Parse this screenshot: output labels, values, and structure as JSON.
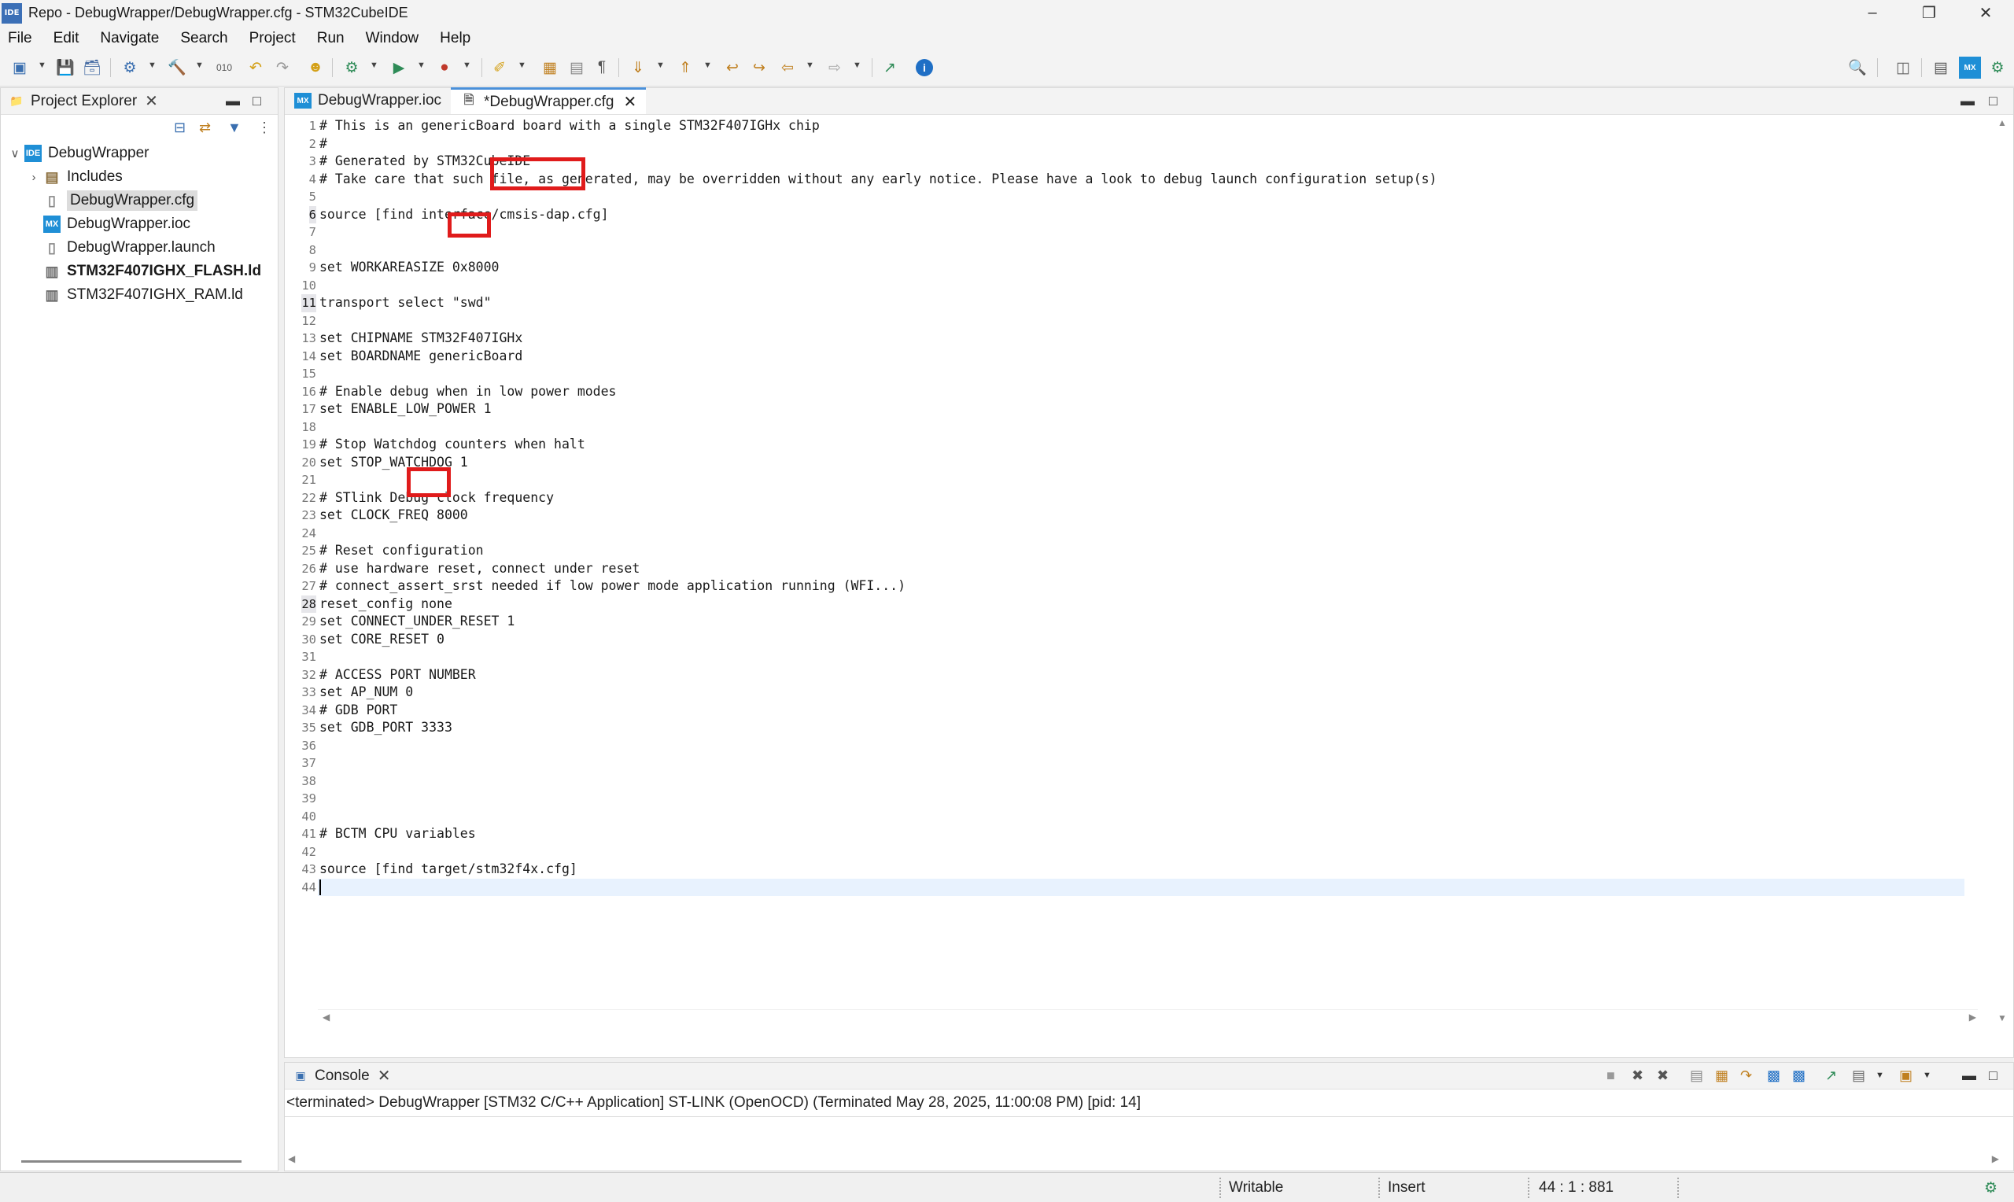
{
  "window": {
    "title": "Repo - DebugWrapper/DebugWrapper.cfg - STM32CubeIDE",
    "icon_text": "IDE"
  },
  "menu": [
    "File",
    "Edit",
    "Navigate",
    "Search",
    "Project",
    "Run",
    "Window",
    "Help"
  ],
  "explorer": {
    "tab_label": "Project Explorer",
    "tree": [
      {
        "label": "DebugWrapper",
        "icon": "project-icon",
        "icon_text": "IDE",
        "bold": false
      },
      {
        "label": "Includes",
        "icon": "includes-icon",
        "icon_text": "",
        "bold": false
      },
      {
        "label": "DebugWrapper.cfg",
        "icon": "file-icon",
        "icon_text": "",
        "bold": false,
        "selected": true
      },
      {
        "label": "DebugWrapper.ioc",
        "icon": "mx-icon",
        "icon_text": "MX",
        "bold": false
      },
      {
        "label": "DebugWrapper.launch",
        "icon": "file-icon",
        "icon_text": "",
        "bold": false
      },
      {
        "label": "STM32F407IGHX_FLASH.ld",
        "icon": "ld-file-icon",
        "icon_text": "",
        "bold": true
      },
      {
        "label": "STM32F407IGHX_RAM.ld",
        "icon": "ld-file-icon",
        "icon_text": "",
        "bold": false
      }
    ]
  },
  "editor": {
    "tabs": [
      {
        "label": "DebugWrapper.ioc",
        "icon_text": "MX",
        "active": false
      },
      {
        "label": "*DebugWrapper.cfg",
        "icon_text": "",
        "active": true
      }
    ],
    "lines": [
      "# This is an genericBoard board with a single STM32F407IGHx chip",
      "#",
      "# Generated by STM32CubeIDE",
      "# Take care that such file, as generated, may be overridden without any early notice. Please have a look to debug launch configuration setup(s)",
      "",
      "source [find interface/cmsis-dap.cfg]",
      "",
      "",
      "set WORKAREASIZE 0x8000",
      "",
      "transport select \"swd\"",
      "",
      "set CHIPNAME STM32F407IGHx",
      "set BOARDNAME genericBoard",
      "",
      "# Enable debug when in low power modes",
      "set ENABLE_LOW_POWER 1",
      "",
      "# Stop Watchdog counters when halt",
      "set STOP_WATCHDOG 1",
      "",
      "# STlink Debug clock frequency",
      "set CLOCK_FREQ 8000",
      "",
      "# Reset configuration",
      "# use hardware reset, connect under reset",
      "# connect_assert_srst needed if low power mode application running (WFI...)",
      "reset_config none",
      "set CONNECT_UNDER_RESET 1",
      "set CORE_RESET 0",
      "",
      "# ACCESS PORT NUMBER",
      "set AP_NUM 0",
      "# GDB PORT",
      "set GDB_PORT 3333",
      "",
      "",
      "",
      "",
      "",
      "# BCTM CPU variables",
      "",
      "source [find target/stm32f4x.cfg]",
      ""
    ],
    "marked_lines": [
      6,
      11,
      28
    ],
    "current_line": 44
  },
  "console": {
    "tab_label": "Console",
    "status": "<terminated> DebugWrapper [STM32 C/C++ Application] ST-LINK (OpenOCD) (Terminated May 28, 2025, 11:00:08 PM) [pid: 14]"
  },
  "statusbar": {
    "writable": "Writable",
    "insert": "Insert",
    "position": "44 : 1 : 881"
  },
  "colors": {
    "highlight_box": "#e01b1b",
    "active_tab_accent": "#4a90d9",
    "current_line": "#e8f2fe"
  }
}
